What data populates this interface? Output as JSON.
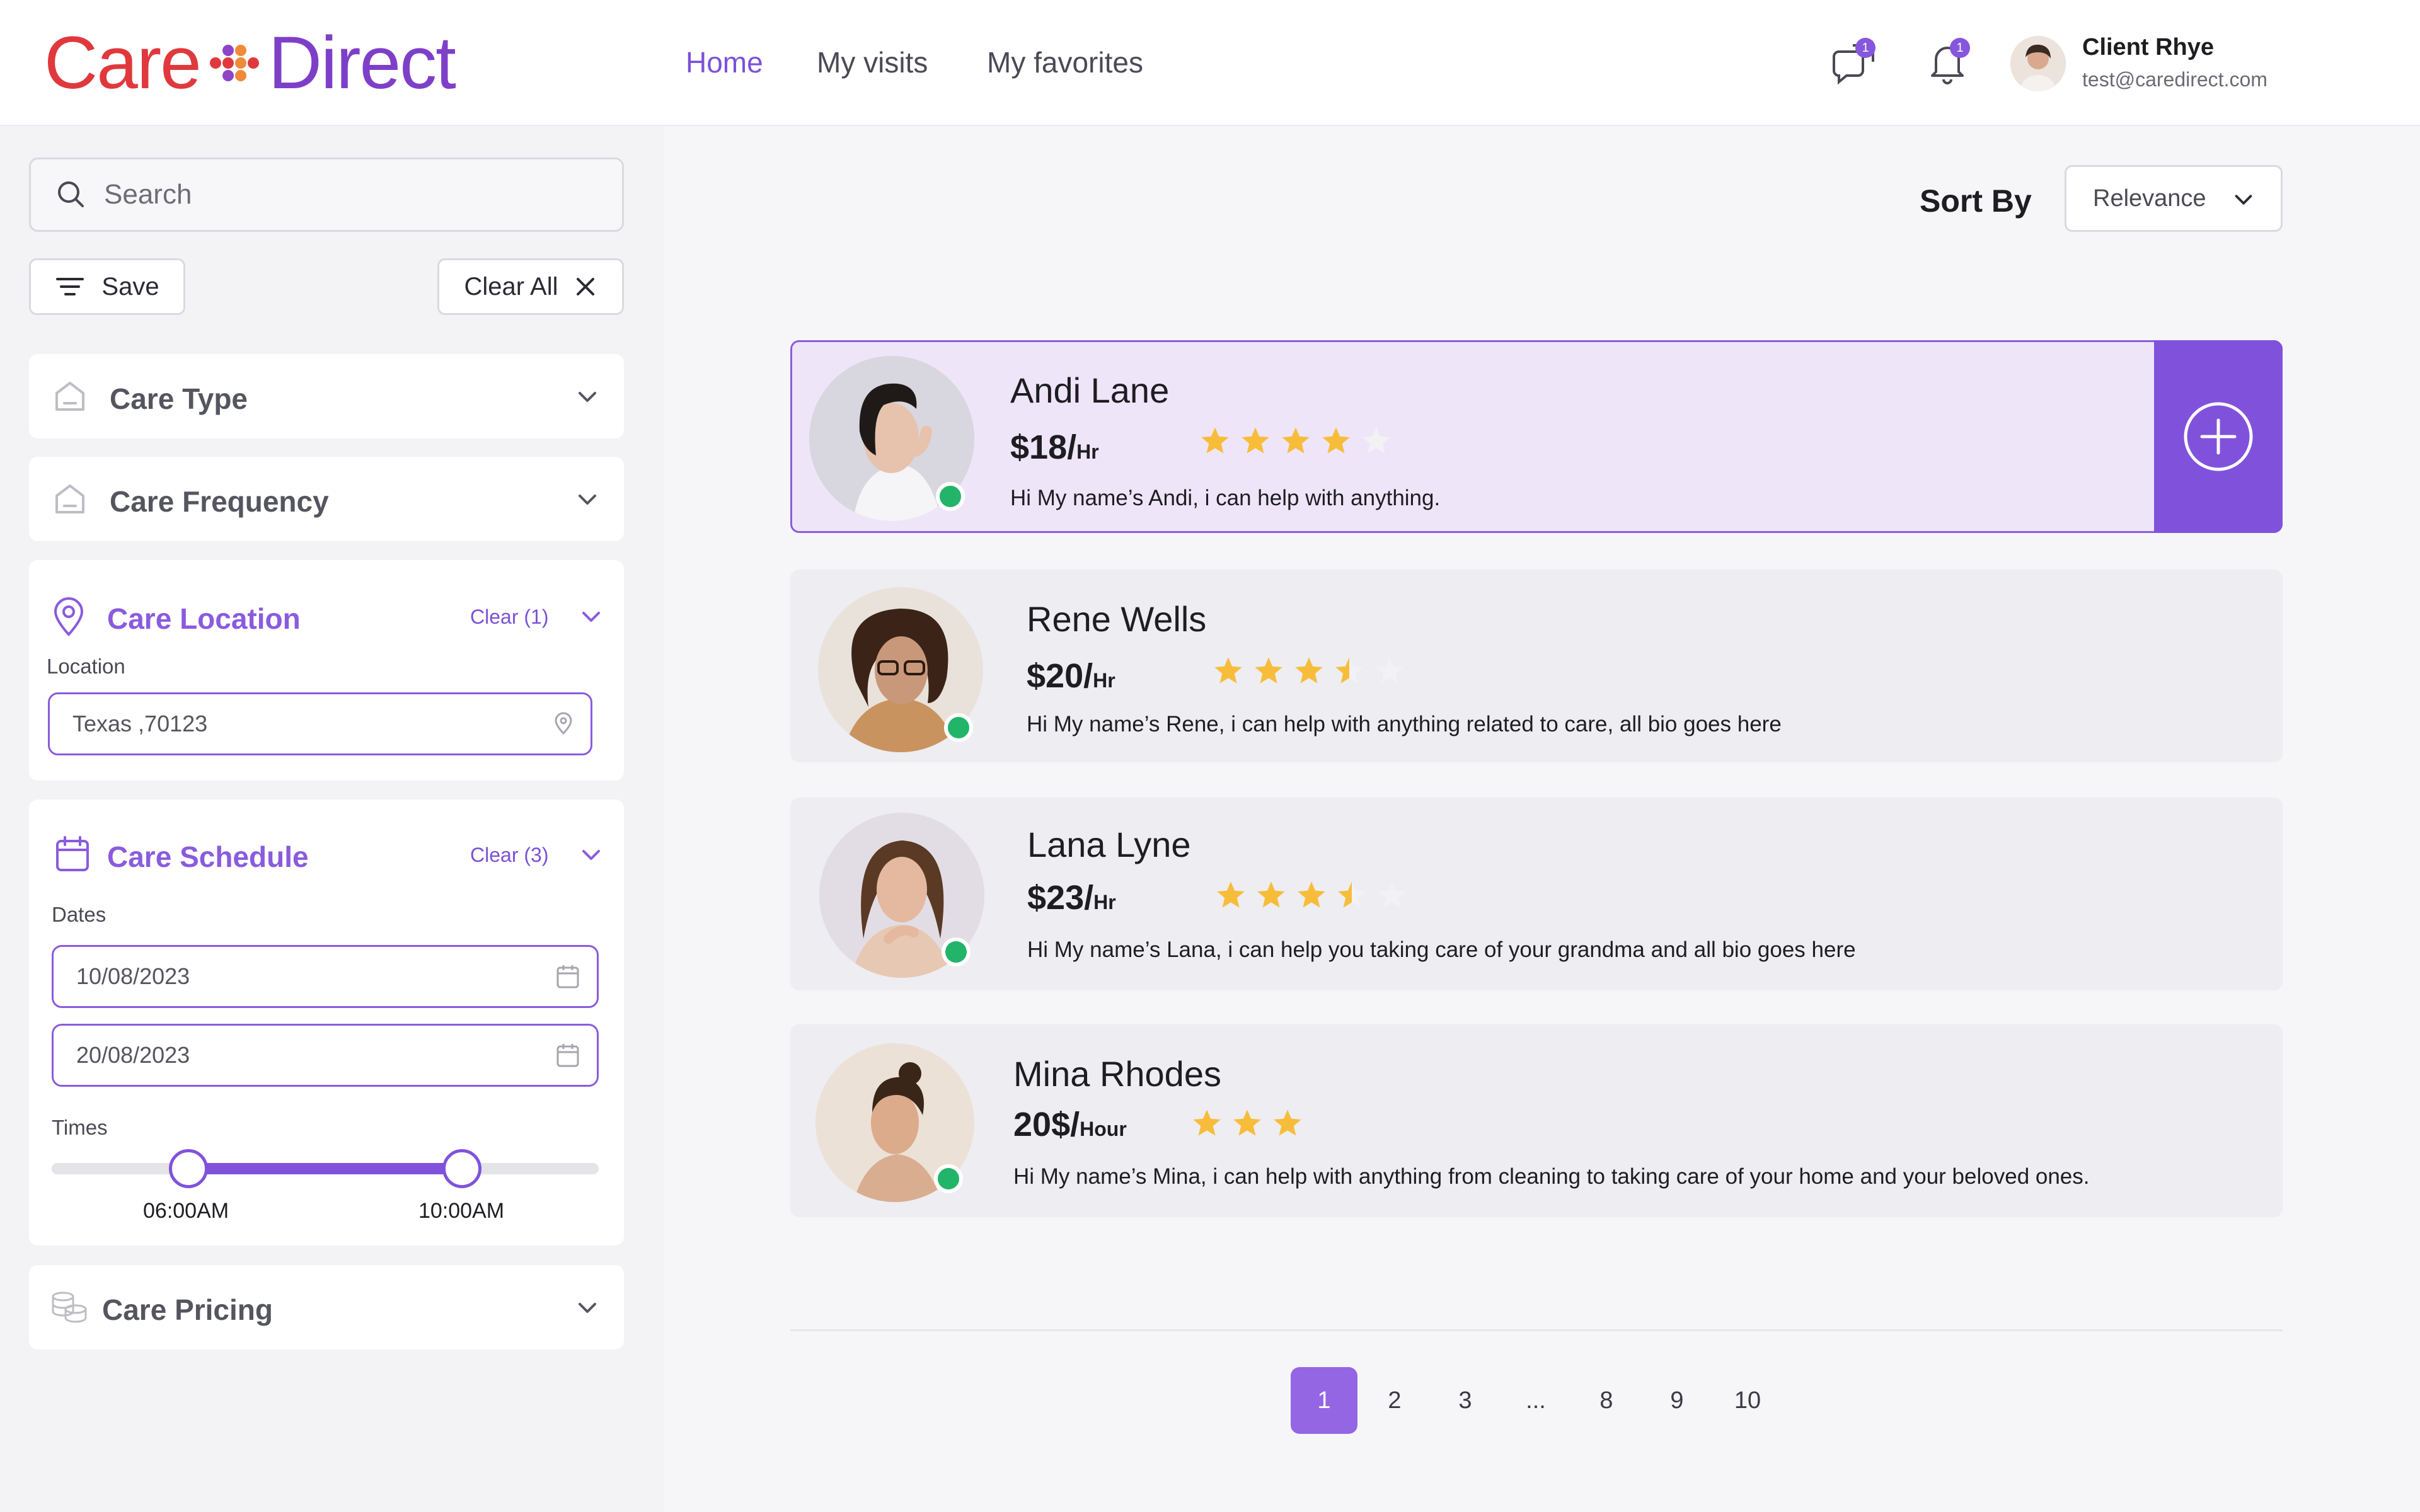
{
  "header": {
    "logo_left": "Care",
    "logo_right": "Direct",
    "nav": [
      "Home",
      "My visits",
      "My favorites"
    ],
    "messages_badge": "1",
    "notifications_badge": "1",
    "user_name": "Client Rhye",
    "user_email": "test@caredirect.com"
  },
  "sidebar": {
    "search_placeholder": "Search",
    "save_label": "Save",
    "clear_all_label": "Clear All",
    "care_type": "Care Type",
    "care_frequency": "Care Frequency",
    "care_location": {
      "title": "Care Location",
      "clear": "Clear (1)",
      "label": "Location",
      "value": "Texas ,70123"
    },
    "care_schedule": {
      "title": "Care Schedule",
      "clear": "Clear (3)",
      "dates_label": "Dates",
      "date_from": "10/08/2023",
      "date_to": "20/08/2023",
      "times_label": "Times",
      "time_from": "06:00AM",
      "time_to": "10:00AM",
      "range_start_fraction": 0.25,
      "range_end_fraction": 0.75
    },
    "care_pricing": "Care Pricing"
  },
  "sort": {
    "label": "Sort By",
    "value": "Relevance"
  },
  "caregivers": [
    {
      "name": "Andi Lane",
      "price": "$18/",
      "unit": "Hr",
      "rating": 4,
      "bio": "Hi My name’s Andi, i can help with anything."
    },
    {
      "name": "Rene Wells",
      "price": "$20/",
      "unit": "Hr",
      "rating": 3.5,
      "bio": "Hi My name’s Rene, i can help with anything related to care, all bio goes here"
    },
    {
      "name": "Lana Lyne",
      "price": "$23/",
      "unit": "Hr",
      "rating": 3.5,
      "bio": "Hi My name’s Lana, i can help you taking care of your grandma and all bio goes here"
    },
    {
      "name": "Mina Rhodes",
      "price": "20$/",
      "unit": "Hour",
      "rating": 3,
      "bio": "Hi My name’s Mina, i can help with anything from cleaning to taking care of your home and your beloved ones."
    }
  ],
  "pagination": {
    "pages": [
      "1",
      "2",
      "3",
      "...",
      "8",
      "9",
      "10"
    ],
    "current": "1"
  },
  "colors": {
    "accent": "#8052dc",
    "star": "#f7bd3a",
    "star_empty": "#f2f2f4",
    "online": "#22b469"
  }
}
